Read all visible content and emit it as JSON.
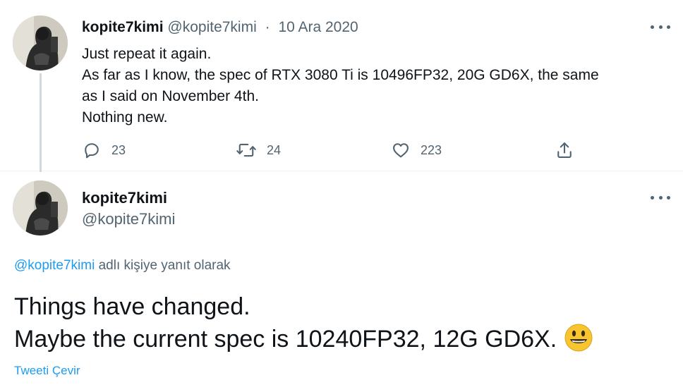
{
  "colors": {
    "link": "#1d9bf0",
    "muted": "#536471",
    "text": "#0f1419",
    "emoji": "#f7c530"
  },
  "first_tweet": {
    "author_name": "kopite7kimi",
    "author_handle": "@kopite7kimi",
    "separator": "·",
    "date": "10 Ara 2020",
    "lines": [
      "Just repeat it again.",
      "As far as I know, the spec of RTX 3080 Ti is 10496FP32, 20G GD6X, the same",
      "as I said on November 4th.",
      "Nothing new."
    ],
    "actions": {
      "reply": {
        "icon": "reply-icon",
        "count": "23"
      },
      "retweet": {
        "icon": "retweet-icon",
        "count": "24"
      },
      "like": {
        "icon": "heart-icon",
        "count": "223"
      },
      "share": {
        "icon": "share-icon"
      }
    },
    "more_icon": "more-icon"
  },
  "second_tweet": {
    "author_name": "kopite7kimi",
    "author_handle": "@kopite7kimi",
    "reply_to": {
      "mention": "@kopite7kimi",
      "suffix": "adlı kişiye yanıt olarak"
    },
    "lines": [
      "Things have changed.",
      "Maybe the current spec is 10240FP32, 12G GD6X."
    ],
    "emoji": "grinning-face-emoji",
    "translate_label": "Tweeti Çevir",
    "more_icon": "more-icon"
  }
}
